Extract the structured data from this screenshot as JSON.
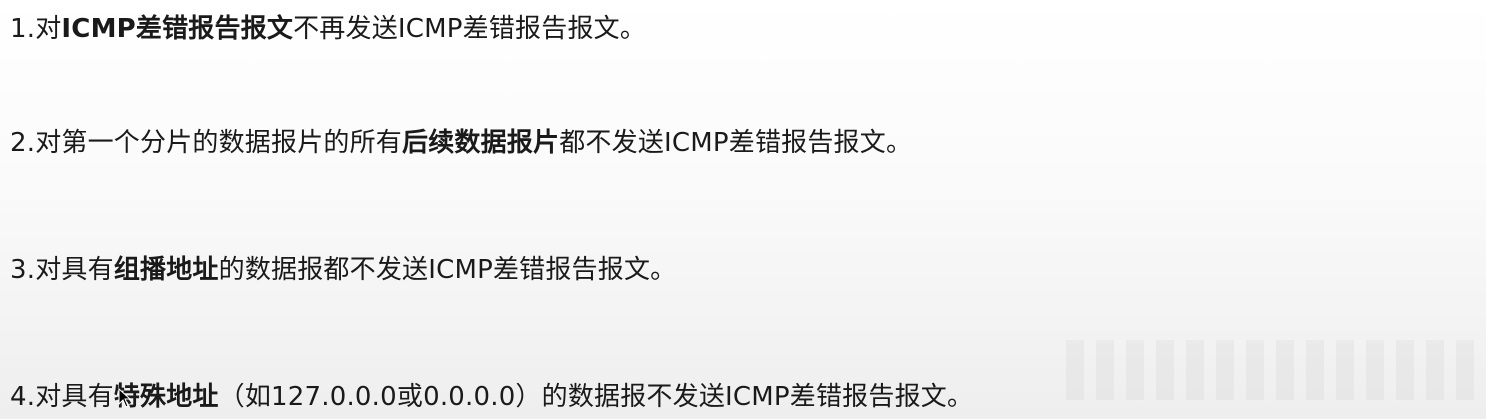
{
  "lines": [
    {
      "prefix": "1.对",
      "bold": "ICMP差错报告报文",
      "suffix": "不再发送ICMP差错报告报文。"
    },
    {
      "prefix": "2.对第一个分片的数据报片的所有",
      "bold": "后续数据报片",
      "suffix": "都不发送ICMP差错报告报文。"
    },
    {
      "prefix": "3.对具有",
      "bold": "组播地址",
      "suffix": "的数据报都不发送ICMP差错报告报文。"
    },
    {
      "prefix": "4.对具有",
      "bold": "特殊地址",
      "suffix": "（如127.0.0.0或0.0.0.0）的数据报不发送ICMP差错报告报文。"
    }
  ],
  "icons": {
    "cursor": "mouse-pointer-icon"
  }
}
